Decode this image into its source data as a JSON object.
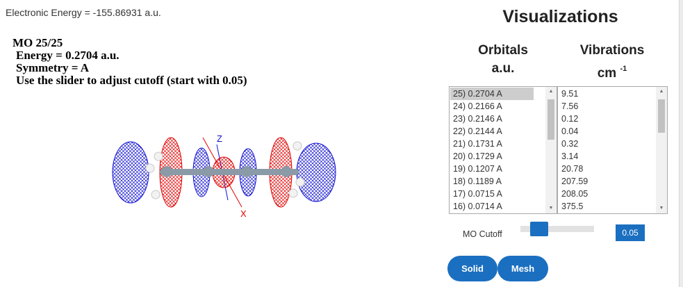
{
  "viewer": {
    "electronic_energy": "Electronic Energy = -155.86931 a.u.",
    "mo_title": "MO 25/25",
    "mo_energy": "Energy = 0.2704 a.u.",
    "mo_symmetry": "Symmetry = A",
    "mo_hint": "Use the slider to adjust cutoff (start with 0.05)",
    "axis_z": "Z",
    "axis_x": "X",
    "colors": {
      "positive_lobe": "#e00000",
      "negative_lobe": "#1010d0",
      "axis_x": "#e00000",
      "axis_z": "#1010d0"
    }
  },
  "panel": {
    "title": "Visualizations",
    "orbitals_header": "Orbitals",
    "orbitals_unit": "a.u.",
    "vibrations_header": "Vibrations",
    "vibrations_unit": "cm",
    "vibrations_unit_exp": "-1",
    "orbitals": [
      "25) 0.2704 A",
      "24) 0.2166 A",
      "23) 0.2146 A",
      "22) 0.2144 A",
      "21) 0.1731 A",
      "20) 0.1729 A",
      "19) 0.1207 A",
      "18) 0.1189 A",
      "17) 0.0715 A",
      "16) 0.0714 A"
    ],
    "orbitals_selected_index": 0,
    "vibrations": [
      "9.51",
      "7.56",
      "0.12",
      "0.04",
      "0.32",
      "3.14",
      "20.78",
      "207.59",
      "208.05",
      "375.5"
    ],
    "cutoff_label": "MO Cutoff",
    "cutoff_value": "0.05",
    "solid_button": "Solid",
    "mesh_button": "Mesh",
    "accent_color": "#1b6fc0"
  }
}
